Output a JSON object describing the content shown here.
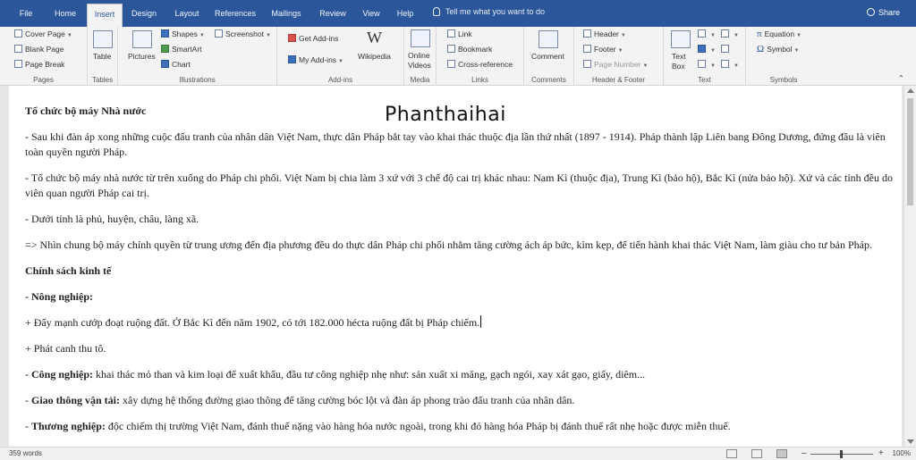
{
  "tabs": [
    "File",
    "Home",
    "Insert",
    "Design",
    "Layout",
    "References",
    "Mailings",
    "Review",
    "View",
    "Help"
  ],
  "active_tab": "Insert",
  "tell_me": "Tell me what you want to do",
  "share": "Share",
  "ribbon": {
    "pages": {
      "label": "Pages",
      "cover": "Cover Page",
      "blank": "Blank Page",
      "break": "Page Break"
    },
    "tables": {
      "label": "Tables",
      "table": "Table"
    },
    "illustrations": {
      "label": "Illustrations",
      "pictures": "Pictures",
      "shapes": "Shapes",
      "smartart": "SmartArt",
      "chart": "Chart",
      "screenshot": "Screenshot"
    },
    "addins": {
      "label": "Add-ins",
      "get": "Get Add-ins",
      "my": "My Add-ins",
      "wiki": "Wikipedia"
    },
    "media": {
      "label": "Media",
      "online": "Online",
      "videos": "Videos"
    },
    "links": {
      "label": "Links",
      "link": "Link",
      "bookmark": "Bookmark",
      "crossref": "Cross-reference"
    },
    "comments": {
      "label": "Comments",
      "comment": "Comment"
    },
    "hf": {
      "label": "Header & Footer",
      "header": "Header",
      "footer": "Footer",
      "pagenum": "Page Number"
    },
    "text": {
      "label": "Text",
      "textbox": "Text",
      "box": "Box"
    },
    "symbols": {
      "label": "Symbols",
      "equation": "Equation",
      "symbol": "Symbol"
    }
  },
  "doc": {
    "watermark": "Phanthaihai",
    "h1": "Tổ chức bộ máy Nhà nước",
    "p1": "- Sau khi đàn áp xong những cuộc đấu tranh của nhân dân Việt Nam, thực dân Pháp bắt tay vào khai thác thuộc địa lần thứ nhất (1897 - 1914). Pháp thành lập Liên bang Đông Dương, đứng đầu là viên toàn quyền người Pháp.",
    "p2": "- Tổ chức bộ máy nhà nước từ trên xuống do Pháp chi phối. Việt Nam bị chia làm 3 xứ với 3 chế độ cai trị khác nhau: Nam Kì (thuộc địa), Trung Kì (bảo hộ), Bắc Kì (nửa bảo hộ). Xứ và các tỉnh đều do viên quan người Pháp cai trị.",
    "p3": "- Dưới tỉnh là phủ, huyện, châu, làng xã.",
    "p4": "=> Nhìn chung bộ máy chính quyền từ trung ương đến địa phương đều do thực dân Pháp chi phối nhằm tăng cường ách áp bức, kìm kẹp, để tiến hành khai thác Việt Nam, làm giàu cho tư bản Pháp.",
    "h2": "Chính sách kinh tế",
    "h3": "- Nông nghiệp:",
    "p5": "+ Đẩy mạnh cướp đoạt ruộng đất. Ở Bắc Kì đến năm 1902, có tới 182.000 hécta ruộng đất bị Pháp chiếm.",
    "p6": "+ Phát canh thu tô.",
    "cn_label": "Công nghiệp:",
    "cn_text": " khai thác mỏ than và kim loại để xuất khẩu, đầu tư công nghiệp nhẹ như: sản xuất xi măng, gạch ngói, xay xát gạo, giấy, diêm...",
    "gt_label": "Giao thông vận tải:",
    "gt_text": " xây dựng hệ thống đường giao thông để tăng cường bóc lột và đàn áp phong trào đấu tranh của nhân dân.",
    "tn_label": "Thương nghiệp:",
    "tn_text": " độc chiếm thị trường Việt Nam, đánh thuế nặng vào hàng hóa nước ngoài, trong khi đó hàng hóa Pháp bị đánh thuế rất nhẹ hoặc được miễn thuế.",
    "dash": "- "
  },
  "status": {
    "words": "359 words",
    "zoom": "100%",
    "minus": "–",
    "plus": "+"
  }
}
